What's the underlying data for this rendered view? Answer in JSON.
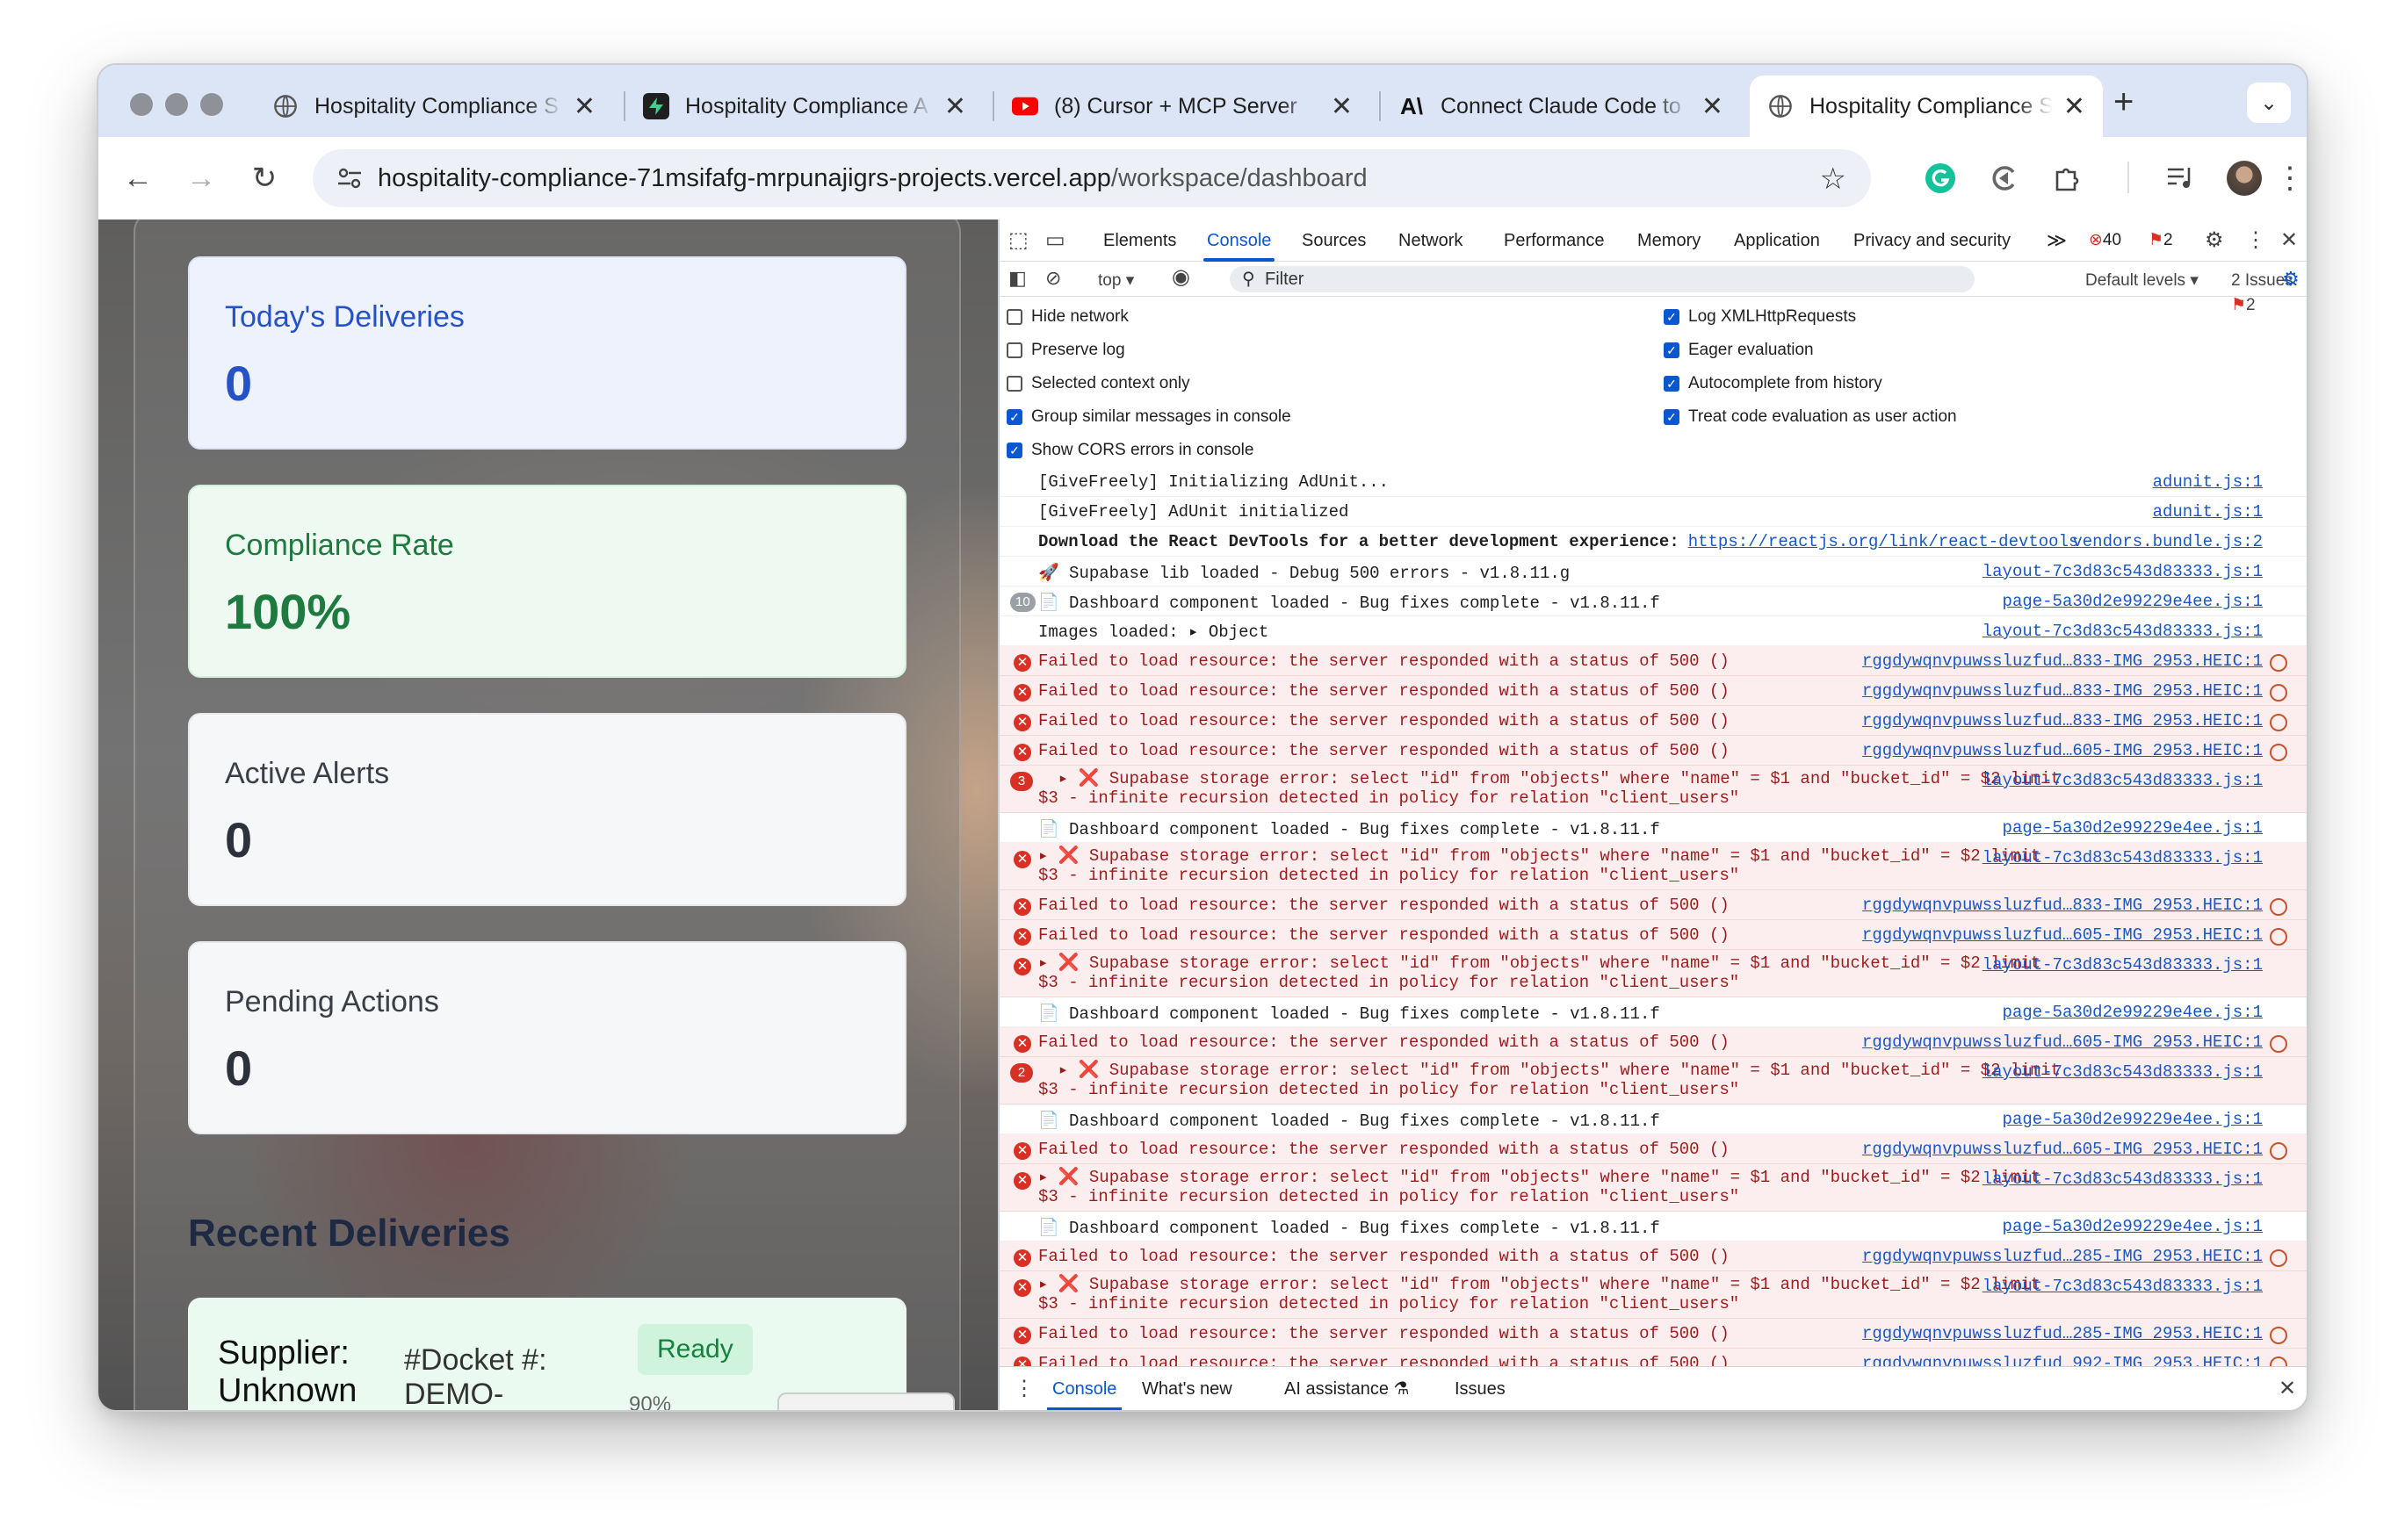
{
  "browser": {
    "tabs": [
      {
        "title": "Hospitality Compliance S",
        "favicon": "globe-icon"
      },
      {
        "title": "Hospitality Compliance A",
        "favicon": "supabase-icon"
      },
      {
        "title": "(8) Cursor + MCP Server",
        "favicon": "youtube-icon"
      },
      {
        "title": "Connect Claude Code to",
        "favicon": "anthropic-icon"
      },
      {
        "title": "Hospitality Compliance S",
        "favicon": "globe-icon",
        "active": true
      }
    ],
    "new_tab": "+",
    "url_host": "hospitality-compliance-71msifafg-mrpunajigrs-projects.vercel.app",
    "url_path": "/workspace/dashboard"
  },
  "dashboard": {
    "cards": [
      {
        "label": "Today's Deliveries",
        "value": "0"
      },
      {
        "label": "Compliance Rate",
        "value": "100%"
      },
      {
        "label": "Active Alerts",
        "value": "0"
      },
      {
        "label": "Pending Actions",
        "value": "0"
      }
    ],
    "recent_title": "Recent Deliveries",
    "delivery": {
      "supplier": "Supplier:",
      "supplier_value": "Unknown",
      "docket": "#Docket #:",
      "docket_value": "DEMO-",
      "status": "Ready",
      "confidence": "90%"
    }
  },
  "devtools": {
    "tabs": [
      "Elements",
      "Console",
      "Sources",
      "Network",
      "Performance",
      "Memory",
      "Application",
      "Privacy and security"
    ],
    "active_tab": "Console",
    "error_count": "40",
    "issue_count": "2",
    "context": "top",
    "filter_placeholder": "Filter",
    "levels": "Default levels",
    "issues_label": "2 Issues:",
    "issues_value": "2",
    "settings_left": [
      {
        "label": "Hide network",
        "checked": false
      },
      {
        "label": "Preserve log",
        "checked": false
      },
      {
        "label": "Selected context only",
        "checked": false
      },
      {
        "label": "Group similar messages in console",
        "checked": true
      },
      {
        "label": "Show CORS errors in console",
        "checked": true
      }
    ],
    "settings_right": [
      {
        "label": "Log XMLHttpRequests",
        "checked": true
      },
      {
        "label": "Eager evaluation",
        "checked": true
      },
      {
        "label": "Autocomplete from history",
        "checked": true
      },
      {
        "label": "Treat code evaluation as user action",
        "checked": true
      }
    ],
    "messages": [
      {
        "type": "log",
        "text": "[GiveFreely] Initializing AdUnit...",
        "src": "adunit.js:1"
      },
      {
        "type": "log",
        "text": "[GiveFreely] AdUnit initialized",
        "src": "adunit.js:1"
      },
      {
        "type": "log-link",
        "text": "Download the React DevTools for a better development experience:",
        "link": "https://reactjs.org/link/react-devtools",
        "src": "vendors.bundle.js:2"
      },
      {
        "type": "log",
        "text": "🚀 Supabase lib loaded - Debug 500 errors - v1.8.11.g",
        "src": "layout-7c3d83c543d83333.js:1"
      },
      {
        "type": "log-count",
        "count": "10",
        "text": "📄 Dashboard component loaded - Bug fixes complete - v1.8.11.f",
        "src": "page-5a30d2e99229e4ee.js:1"
      },
      {
        "type": "log",
        "text": "Images loaded:  ▸ Object",
        "src": "layout-7c3d83c543d83333.js:1"
      },
      {
        "type": "net",
        "text": "Failed to load resource: the server responded with a status of 500 ()",
        "src": "rggdywqnvpuwssluzfud…833-IMG_2953.HEIC:1"
      },
      {
        "type": "net",
        "text": "Failed to load resource: the server responded with a status of 500 ()",
        "src": "rggdywqnvpuwssluzfud…833-IMG_2953.HEIC:1"
      },
      {
        "type": "net",
        "text": "Failed to load resource: the server responded with a status of 500 ()",
        "src": "rggdywqnvpuwssluzfud…833-IMG_2953.HEIC:1"
      },
      {
        "type": "net",
        "text": "Failed to load resource: the server responded with a status of 500 ()",
        "src": "rggdywqnvpuwssluzfud…605-IMG_2953.HEIC:1"
      },
      {
        "type": "sup",
        "count": "3",
        "text": "  ▸ ❌ Supabase storage error: select \"id\" from \"objects\" where \"name\" = $1 and \"bucket_id\" = $2 limit\n$3 - infinite recursion detected in policy for relation \"client_users\"",
        "src": "layout-7c3d83c543d83333.js:1"
      },
      {
        "type": "log",
        "text": "    📄 Dashboard component loaded - Bug fixes complete - v1.8.11.f",
        "src": "page-5a30d2e99229e4ee.js:1"
      },
      {
        "type": "sup",
        "text": "▸ ❌ Supabase storage error: select \"id\" from \"objects\" where \"name\" = $1 and \"bucket_id\" = $2 limit\n$3 - infinite recursion detected in policy for relation \"client_users\"",
        "src": "layout-7c3d83c543d83333.js:1"
      },
      {
        "type": "net",
        "text": "Failed to load resource: the server responded with a status of 500 ()",
        "src": "rggdywqnvpuwssluzfud…833-IMG_2953.HEIC:1"
      },
      {
        "type": "net",
        "text": "Failed to load resource: the server responded with a status of 500 ()",
        "src": "rggdywqnvpuwssluzfud…605-IMG_2953.HEIC:1"
      },
      {
        "type": "sup",
        "text": "▸ ❌ Supabase storage error: select \"id\" from \"objects\" where \"name\" = $1 and \"bucket_id\" = $2 limit\n$3 - infinite recursion detected in policy for relation \"client_users\"",
        "src": "layout-7c3d83c543d83333.js:1"
      },
      {
        "type": "log",
        "text": "    📄 Dashboard component loaded - Bug fixes complete - v1.8.11.f",
        "src": "page-5a30d2e99229e4ee.js:1"
      },
      {
        "type": "net",
        "text": "Failed to load resource: the server responded with a status of 500 ()",
        "src": "rggdywqnvpuwssluzfud…605-IMG_2953.HEIC:1"
      },
      {
        "type": "sup",
        "count": "2",
        "text": "  ▸ ❌ Supabase storage error: select \"id\" from \"objects\" where \"name\" = $1 and \"bucket_id\" = $2 limit\n$3 - infinite recursion detected in policy for relation \"client_users\"",
        "src": "layout-7c3d83c543d83333.js:1"
      },
      {
        "type": "log",
        "text": "    📄 Dashboard component loaded - Bug fixes complete - v1.8.11.f",
        "src": "page-5a30d2e99229e4ee.js:1"
      },
      {
        "type": "net",
        "text": "Failed to load resource: the server responded with a status of 500 ()",
        "src": "rggdywqnvpuwssluzfud…605-IMG_2953.HEIC:1"
      },
      {
        "type": "sup",
        "text": "▸ ❌ Supabase storage error: select \"id\" from \"objects\" where \"name\" = $1 and \"bucket_id\" = $2 limit\n$3 - infinite recursion detected in policy for relation \"client_users\"",
        "src": "layout-7c3d83c543d83333.js:1"
      },
      {
        "type": "log",
        "text": "    📄 Dashboard component loaded - Bug fixes complete - v1.8.11.f",
        "src": "page-5a30d2e99229e4ee.js:1"
      },
      {
        "type": "net",
        "text": "Failed to load resource: the server responded with a status of 500 ()",
        "src": "rggdywqnvpuwssluzfud…285-IMG_2953.HEIC:1"
      },
      {
        "type": "sup",
        "text": "▸ ❌ Supabase storage error: select \"id\" from \"objects\" where \"name\" = $1 and \"bucket_id\" = $2 limit\n$3 - infinite recursion detected in policy for relation \"client_users\"",
        "src": "layout-7c3d83c543d83333.js:1"
      },
      {
        "type": "net",
        "text": "Failed to load resource: the server responded with a status of 500 ()",
        "src": "rggdywqnvpuwssluzfud…285-IMG_2953.HEIC:1"
      },
      {
        "type": "net",
        "text": "Failed to load resource: the server responded with a status of 500 ()",
        "src": "rggdywqnvpuwssluzfud…992-IMG_2953.HEIC:1"
      }
    ],
    "drawer_tabs": [
      "Console",
      "What's new",
      "AI assistance ⚗",
      "Issues"
    ]
  },
  "colors": {
    "accent": "#0b57d0",
    "error": "#d93025",
    "success": "#17803d"
  }
}
